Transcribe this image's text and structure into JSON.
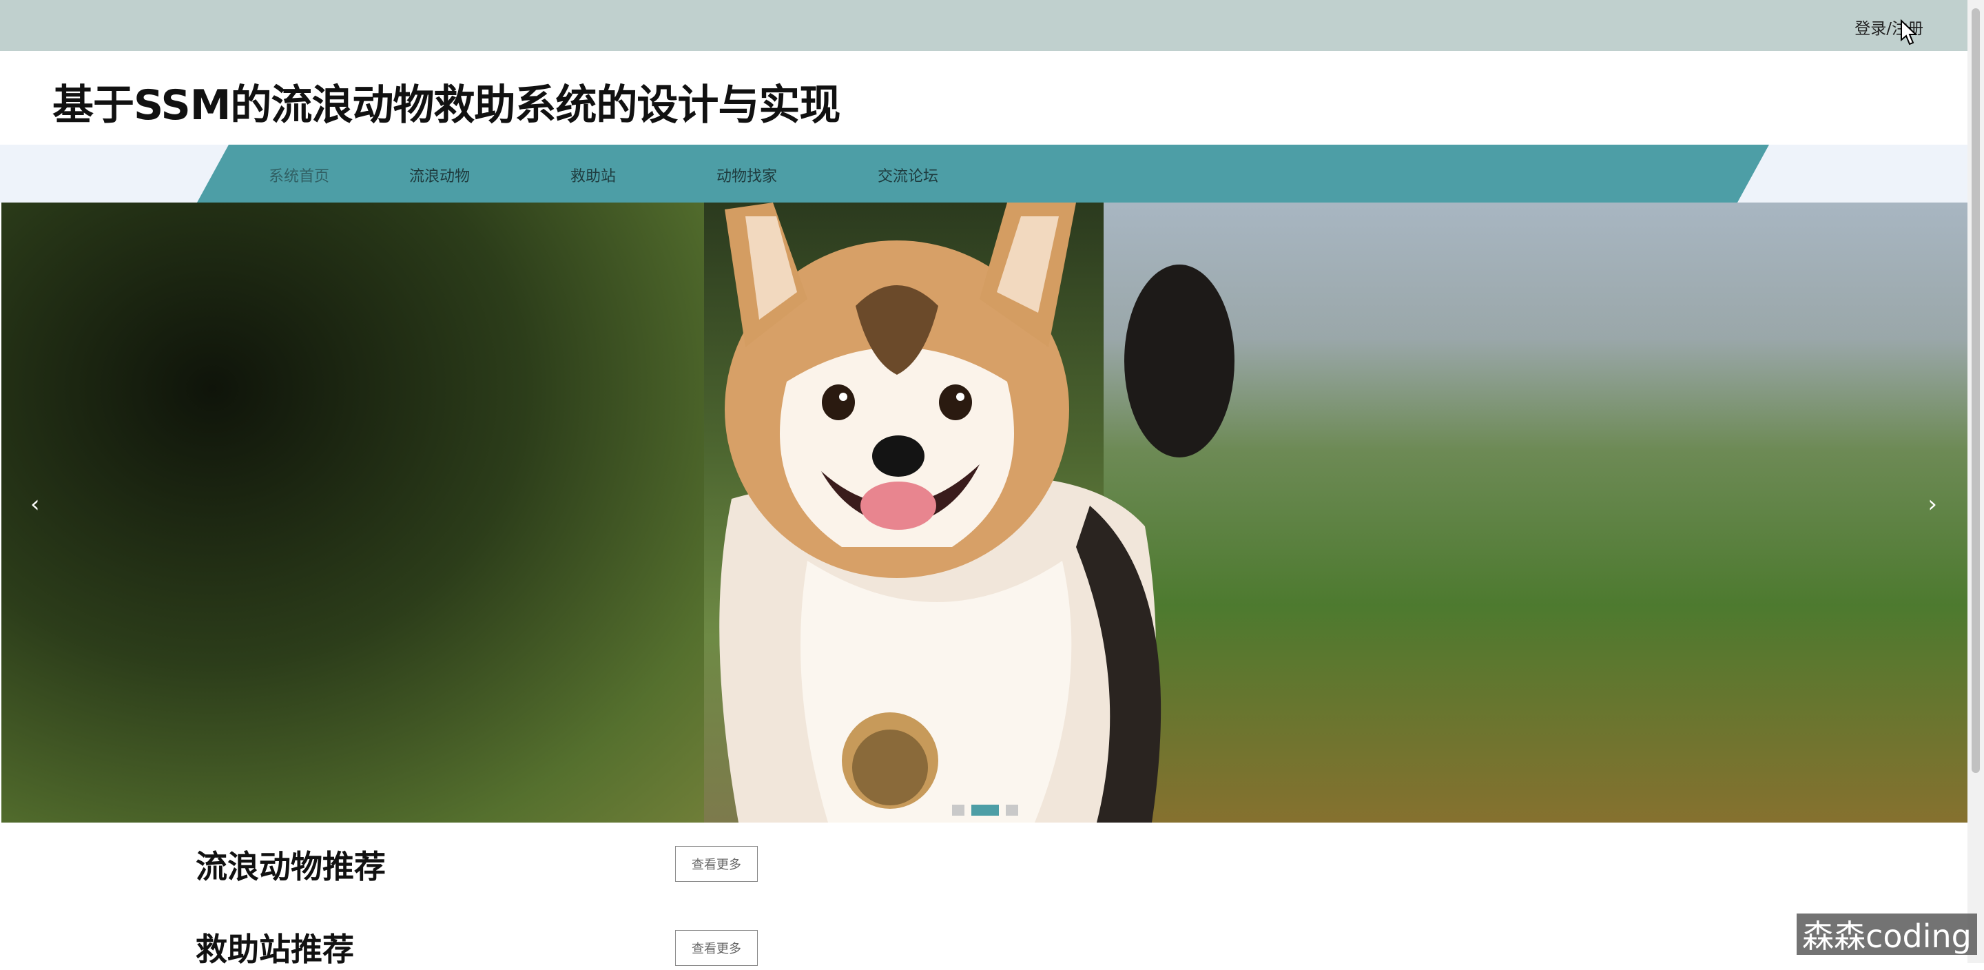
{
  "topbar": {
    "login_label": "登录/注册"
  },
  "header": {
    "title": "基于SSM的流浪动物救助系统的设计与实现"
  },
  "nav": {
    "items": [
      {
        "label": "系统首页"
      },
      {
        "label": "流浪动物"
      },
      {
        "label": "救助站"
      },
      {
        "label": "动物找家"
      },
      {
        "label": "交流论坛"
      }
    ]
  },
  "carousel": {
    "prev_icon": "chevron-left-icon",
    "next_icon": "chevron-right-icon",
    "prev_glyph": "‹",
    "next_glyph": "›",
    "image": "corgi-photo",
    "slide_count": 3,
    "active_index": 1
  },
  "sections": [
    {
      "title": "流浪动物推荐",
      "more_label": "查看更多"
    },
    {
      "title": "救助站推荐",
      "more_label": "查看更多"
    }
  ],
  "watermark": {
    "text": "森森coding"
  },
  "colors": {
    "topbar_bg": "#c0d0ce",
    "nav_bg": "#4d9ea6",
    "accent": "#4d9ea6"
  }
}
